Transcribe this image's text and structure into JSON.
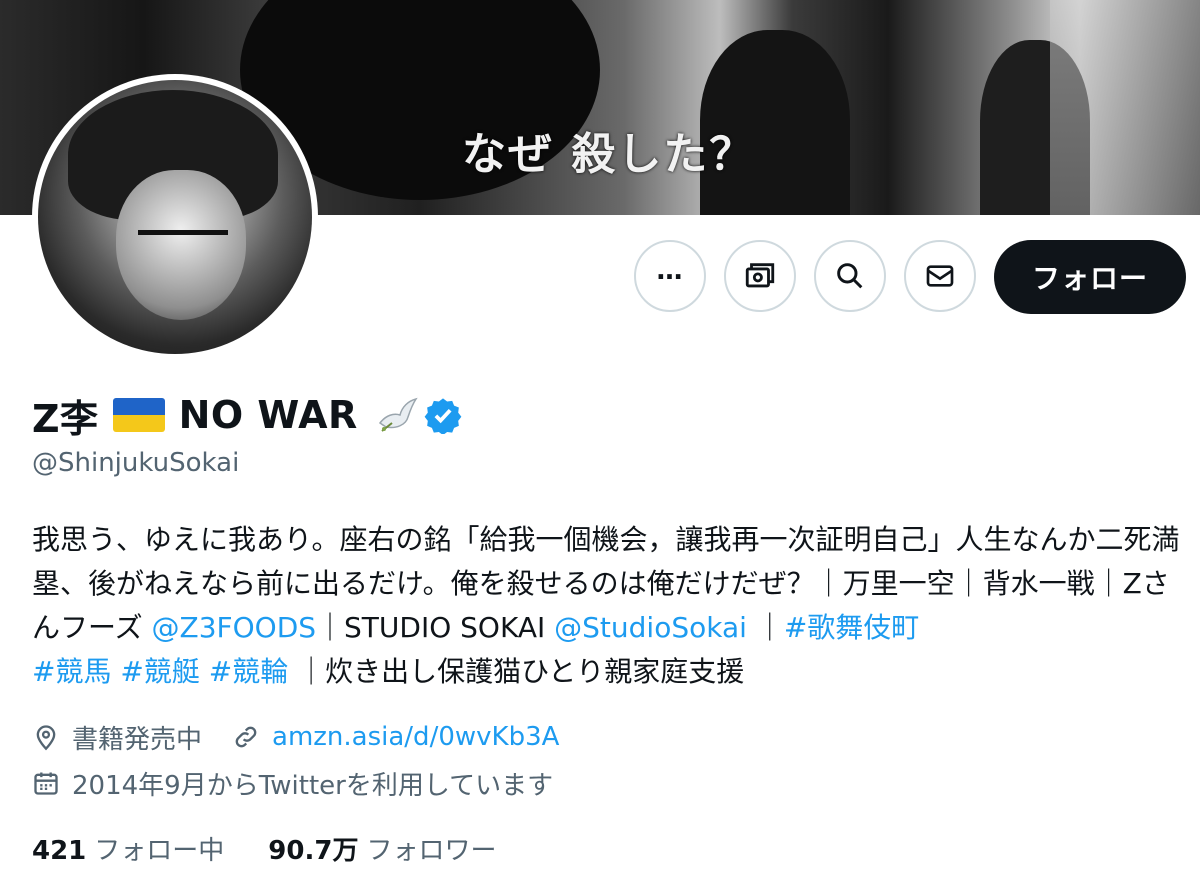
{
  "banner": {
    "caption": "なぜ 殺した？"
  },
  "actions": {
    "more_label": "…",
    "follow_label": "フォロー"
  },
  "profile": {
    "name": "Z李",
    "name_suffix": "NO WAR",
    "handle": "@ShinjukuSokai"
  },
  "bio": {
    "text1": "我思う、ゆえに我あり。座右の銘「給我一個機会，讓我再一次証明自己」人生なんか二死満塁、後がねえなら前に出るだけ。俺を殺せるのは俺だけだぜ？｜万里一空｜背水一戦｜Zさんフーズ ",
    "link1": "@Z3FOODS",
    "text2": "｜STUDIO SOKAI ",
    "link2": "@StudioSokai",
    "text3": " ｜",
    "link3": "#歌舞伎町",
    "link4": "#競馬",
    "link5": "#競艇",
    "link6": "#競輪",
    "text4": " ｜炊き出し保護猫ひとり親家庭支援"
  },
  "meta": {
    "location": "書籍発売中",
    "url": "amzn.asia/d/0wvKb3A",
    "joined": "2014年9月からTwitterを利用しています"
  },
  "counts": {
    "following_num": "421",
    "following_label": "フォロー中",
    "followers_num": "90.7万",
    "followers_label": "フォロワー"
  },
  "colors": {
    "accent": "#1d9bf0",
    "text": "#0f1419",
    "muted": "#536471",
    "follow_bg": "#0f1419"
  }
}
